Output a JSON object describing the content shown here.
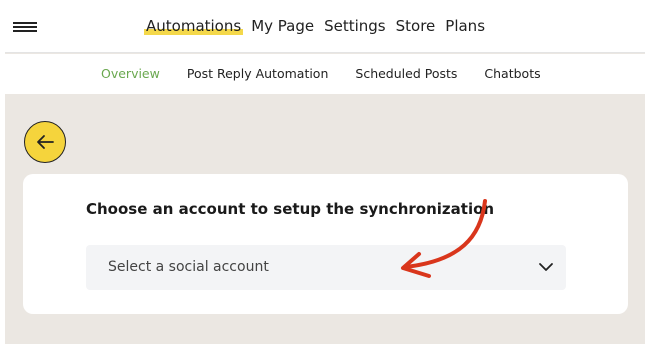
{
  "header": {
    "menu_icon": "hamburger-menu-icon",
    "nav": [
      {
        "label": "Automations",
        "active": true
      },
      {
        "label": "My Page",
        "active": false
      },
      {
        "label": "Settings",
        "active": false
      },
      {
        "label": "Store",
        "active": false
      },
      {
        "label": "Plans",
        "active": false
      }
    ]
  },
  "subnav": [
    {
      "label": "Overview",
      "active": true
    },
    {
      "label": "Post Reply Automation",
      "active": false
    },
    {
      "label": "Scheduled Posts",
      "active": false
    },
    {
      "label": "Chatbots",
      "active": false
    }
  ],
  "back_button": {
    "icon": "arrow-left-icon"
  },
  "card": {
    "title": "Choose an account to setup the synchronization",
    "select": {
      "placeholder": "Select a social account",
      "icon": "chevron-down-icon"
    }
  },
  "colors": {
    "accent_yellow": "#f5d43c",
    "active_subnav_green": "#6aa84f",
    "annotation_arrow_red": "#d9361c",
    "background": "#ebe7e2"
  }
}
